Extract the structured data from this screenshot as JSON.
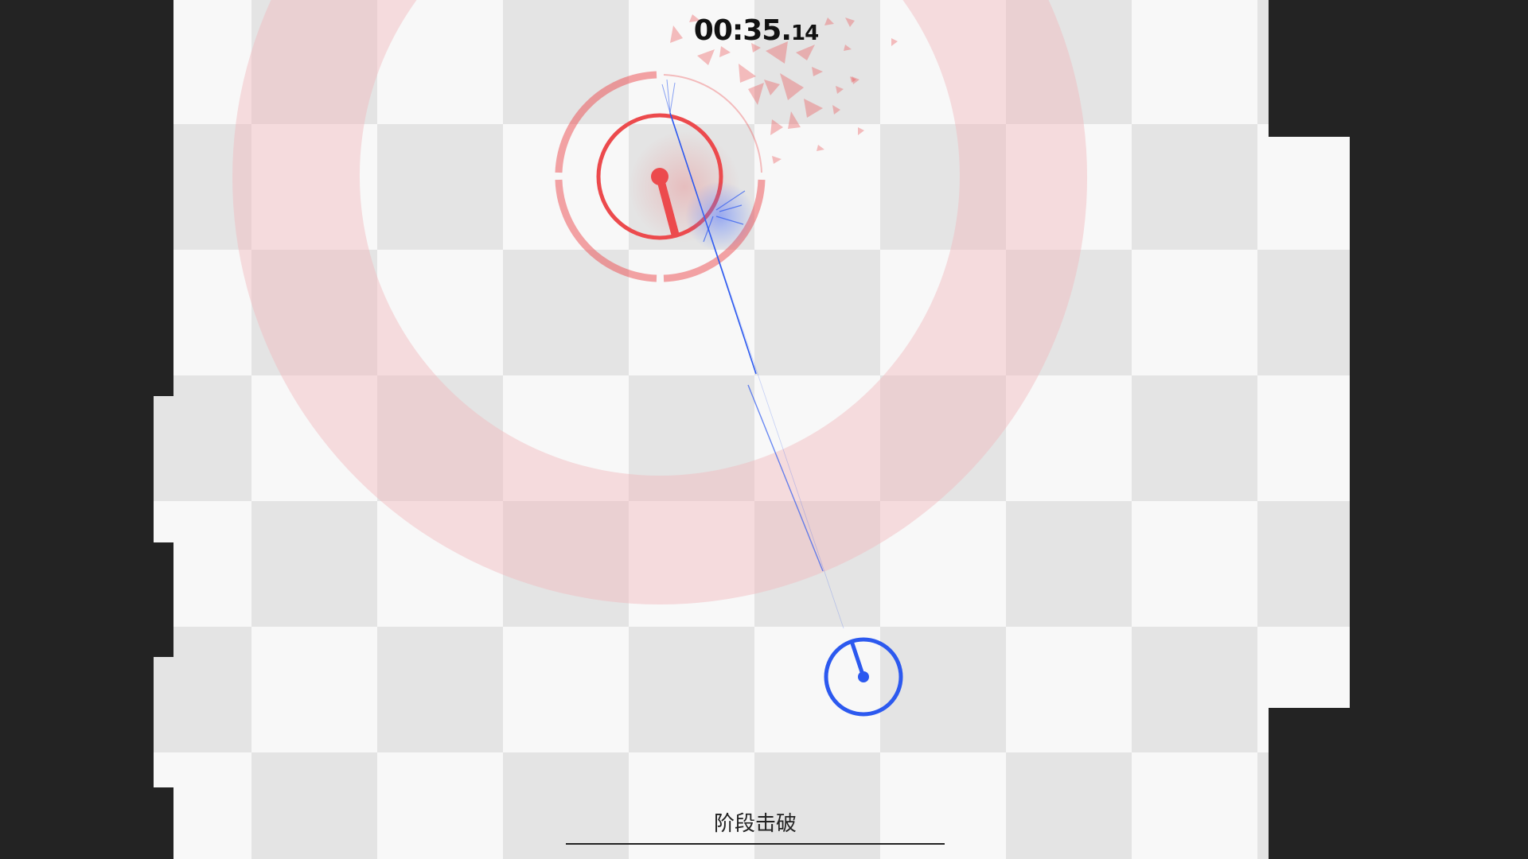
{
  "hud": {
    "timer_main": "00:35.",
    "timer_centis": "14"
  },
  "banner": {
    "text": "阶段击破"
  },
  "colors": {
    "background": "#232323",
    "tile_light": "#f8f8f8",
    "tile_dark": "#e4e4e4",
    "enemy": "#ec4a4d",
    "enemy_ring": "#f0a0a4",
    "danger_zone": "#f2b9bd",
    "player": "#2c59ef",
    "text": "#111111"
  },
  "entities": {
    "enemy": {
      "type": "boss-core",
      "icon": "enemy-core-icon"
    },
    "player": {
      "type": "player-core",
      "icon": "player-core-icon"
    }
  }
}
